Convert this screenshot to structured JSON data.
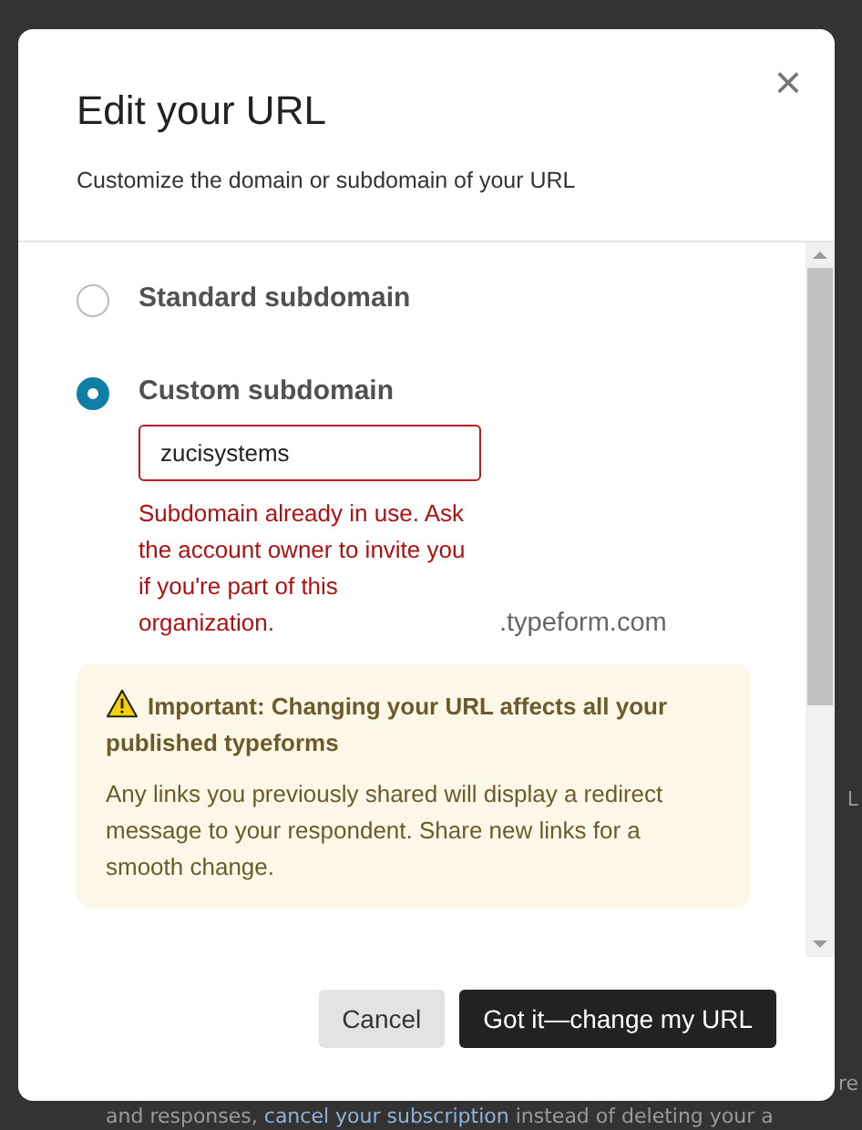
{
  "background": {
    "side_fragments": [
      "L",
      "re"
    ],
    "bottom_line": {
      "before": "and responses, ",
      "link": "cancel your subscription",
      "after": " instead of deleting your a"
    }
  },
  "dialog": {
    "title": "Edit your URL",
    "subtitle": "Customize the domain or subdomain of your URL",
    "close": "×"
  },
  "options": [
    {
      "label": "Standard subdomain",
      "selected": false
    },
    {
      "label": "Custom subdomain",
      "selected": true,
      "value": "zucisystems",
      "error": "Subdomain already in use. Ask the account owner to invite you if you're part of this organization.",
      "suffix": ".typeform.com"
    }
  ],
  "notice": {
    "title": "Important: Changing your URL affects all your published typeforms",
    "body": "Any links you previously shared will display a redirect message to your respondent. Share new links for a smooth change."
  },
  "buttons": [
    {
      "label": "Cancel",
      "kind": "secondary"
    },
    {
      "label": "Got it—change my URL",
      "kind": "primary"
    }
  ]
}
